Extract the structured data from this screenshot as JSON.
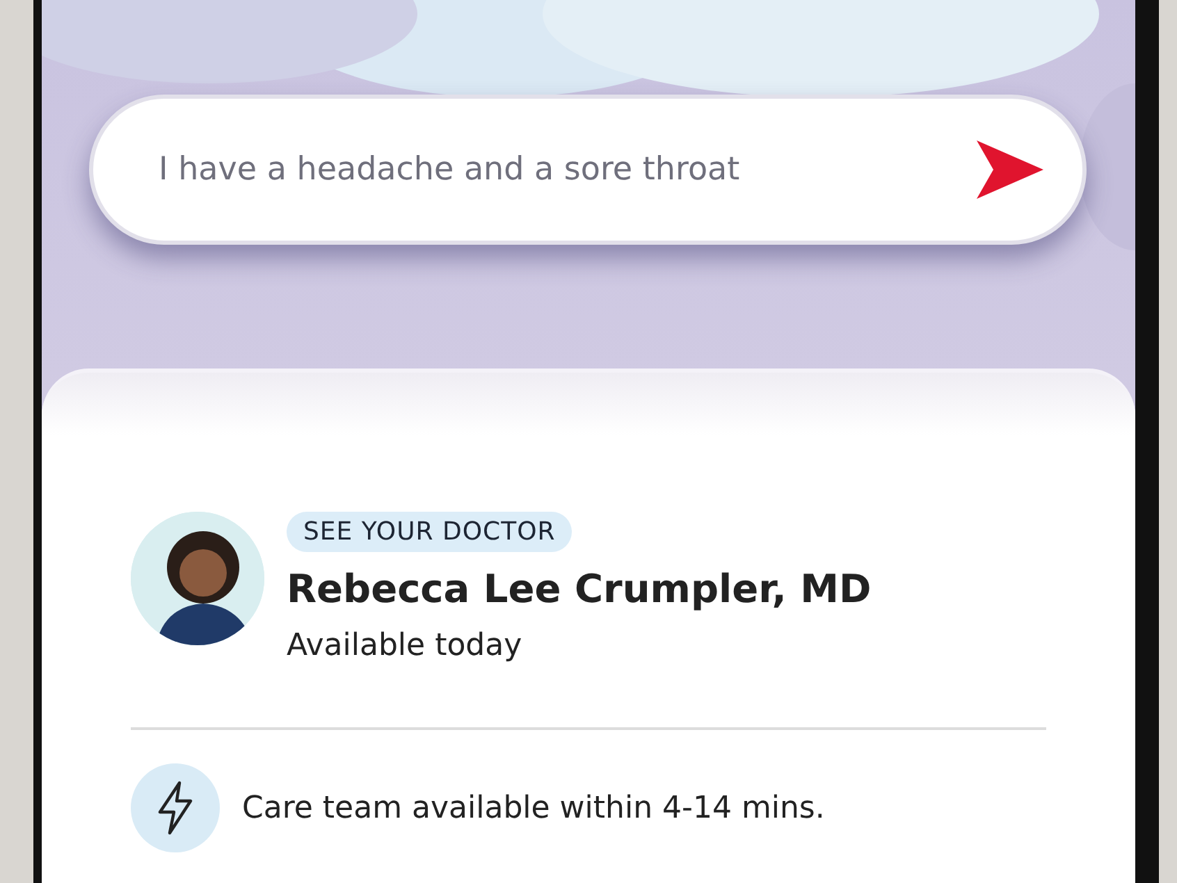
{
  "search": {
    "placeholder": "I have a headache and a sore throat"
  },
  "doctor": {
    "badge": "SEE YOUR DOCTOR",
    "name": "Rebecca Lee Crumpler, MD",
    "availability": "Available today"
  },
  "care_team": {
    "text": "Care team available within 4-14 mins."
  }
}
